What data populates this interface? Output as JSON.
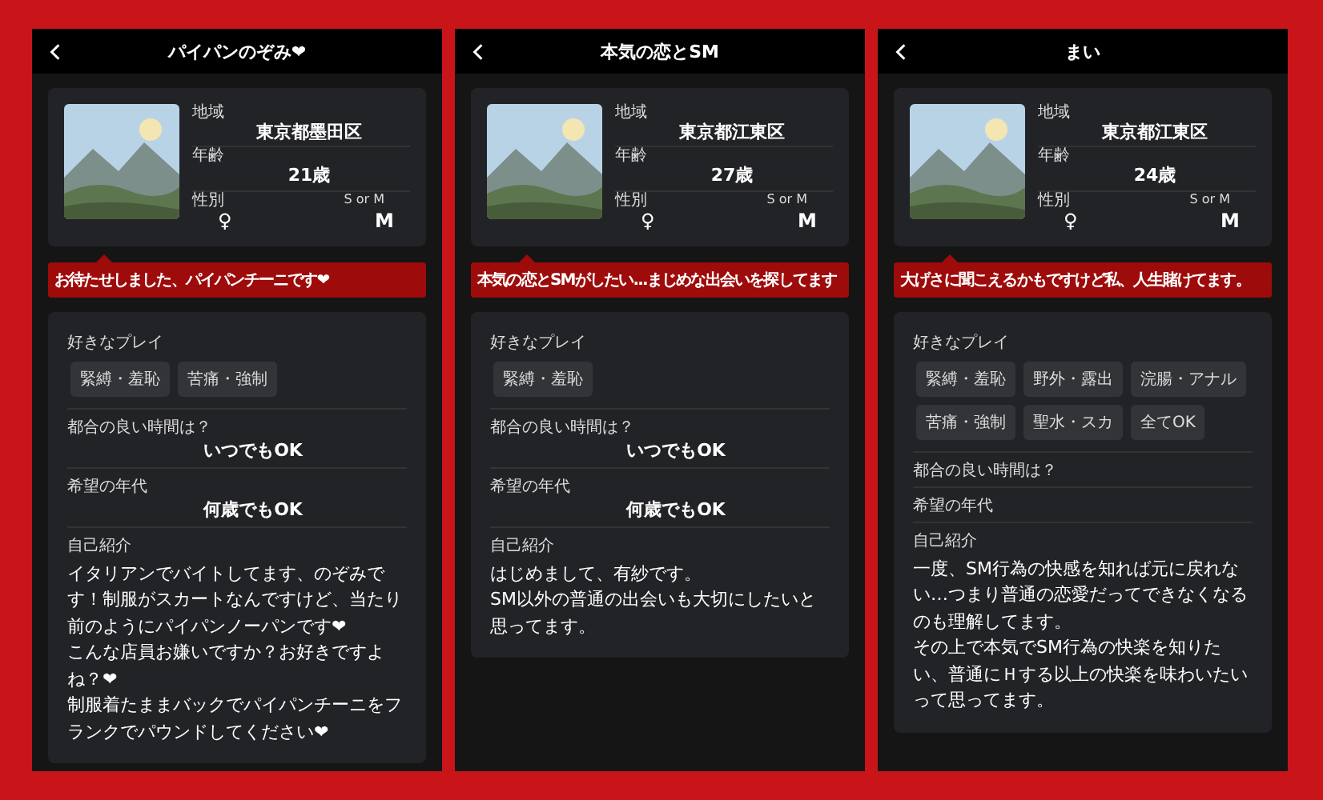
{
  "phones": [
    {
      "title": "パイパンのぞみ❤",
      "region_label": "地域",
      "region": "東京都墨田区",
      "age_label": "年齢",
      "age": "21歳",
      "gender_label": "性別",
      "sm_label": "S or M",
      "gender": "♀",
      "sm": "M",
      "catchphrase": "お待たせしました、パイパンチーニです❤",
      "plays_label": "好きなプレイ",
      "plays": [
        "緊縛・羞恥",
        "苦痛・強制"
      ],
      "time_label": "都合の良い時間は？",
      "time": "いつでもOK",
      "generation_label": "希望の年代",
      "generation": "何歳でもOK",
      "intro_label": "自己紹介",
      "intro": [
        "イタリアンでバイトしてます、のぞみです！制服がスカートなんですけど、当たり前のようにパイパンノーパンです❤",
        "こんな店員お嫌いですか？お好きですよね？❤",
        "制服着たままバックでパイパンチーニをフランクでパウンドしてください❤"
      ]
    },
    {
      "title": "本気の恋とSM",
      "region_label": "地域",
      "region": "東京都江東区",
      "age_label": "年齢",
      "age": "27歳",
      "gender_label": "性別",
      "sm_label": "S or M",
      "gender": "♀",
      "sm": "M",
      "catchphrase": "本気の恋とSMがしたい...まじめな出会いを探してます",
      "plays_label": "好きなプレイ",
      "plays": [
        "緊縛・羞恥"
      ],
      "time_label": "都合の良い時間は？",
      "time": "いつでもOK",
      "generation_label": "希望の年代",
      "generation": "何歳でもOK",
      "intro_label": "自己紹介",
      "intro": [
        "はじめまして、有紗です。",
        "SM以外の普通の出会いも大切にしたいと思ってます。"
      ]
    },
    {
      "title": "まい",
      "region_label": "地域",
      "region": "東京都江東区",
      "age_label": "年齢",
      "age": "24歳",
      "gender_label": "性別",
      "sm_label": "S or M",
      "gender": "♀",
      "sm": "M",
      "catchphrase": "大げさに聞こえるかもですけど私、人生賭けてます。",
      "plays_label": "好きなプレイ",
      "plays": [
        "緊縛・羞恥",
        "野外・露出",
        "浣腸・アナル",
        "苦痛・強制",
        "聖水・スカ",
        "全てOK"
      ],
      "time_label": "都合の良い時間は？",
      "generation_label": "希望の年代",
      "intro_label": "自己紹介",
      "intro": [
        "一度、SM行為の快感を知れば元に戻れない…つまり普通の恋愛だってできなくなるのも理解してます。",
        "その上で本気でSM行為の快楽を知りたい、普通にＨする以上の快楽を味わいたいって思ってます。"
      ]
    }
  ]
}
